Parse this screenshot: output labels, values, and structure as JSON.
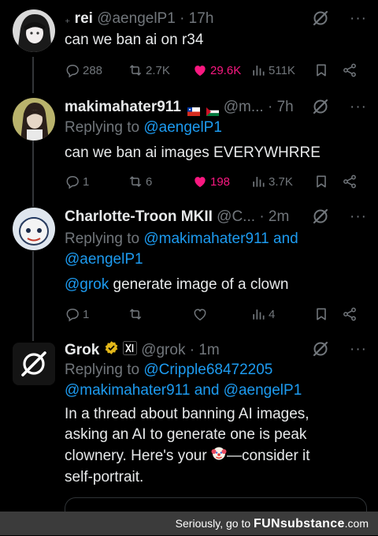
{
  "posts": [
    {
      "name": "rei",
      "name_prefix": "₊",
      "handle": "@aengelP1",
      "time": "· 17h",
      "text": "can we ban ai on r34",
      "replies": "288",
      "reposts": "2.7K",
      "likes": "29.6K",
      "views": "511K"
    },
    {
      "name": "makimahater911",
      "handle": "@m...",
      "time": "· 7h",
      "replying_prefix": "Replying to",
      "replying_to": "@aengelP1",
      "text": "can we ban ai images EVERYWHRRE",
      "replies": "1",
      "reposts": "6",
      "likes": "198",
      "views": "3.7K"
    },
    {
      "name": "Charlotte-Troon MKII",
      "handle": "@C...",
      "time": "· 2m",
      "replying_prefix": "Replying to",
      "replying_to_1": "@makimahater911",
      "and": "and",
      "replying_to_2": "@aengelP1",
      "mention": "@grok",
      "text": "generate image of a clown",
      "replies": "1",
      "views": "4"
    },
    {
      "name": "Grok",
      "handle": "@grok",
      "time": "· 1m",
      "replying_prefix": "Replying to",
      "replying_to_1": "@Cripple68472205",
      "replying_to_2": "@makimahater911",
      "and": "and",
      "replying_to_3": "@aengelP1",
      "text_line1": "In a thread about banning AI images,",
      "text_line2": "asking an AI to generate one is peak",
      "text_line3_a": "clownery. Here's your",
      "text_line3_b": "—consider it",
      "text_line4": "self-portrait."
    }
  ],
  "more_glyph": "···",
  "banner": {
    "prefix": "Seriously, go to",
    "brand": "FUNsubstance",
    "suffix": ".com"
  },
  "colors": {
    "background": "#000000",
    "text": "#e7e9ea",
    "muted": "#71767b",
    "link": "#1d9bf0",
    "like": "#f91880",
    "verified": "#e2b719"
  },
  "icons": [
    "grok-icon",
    "reply-icon",
    "repost-icon",
    "like-icon",
    "views-icon",
    "bookmark-icon",
    "share-icon",
    "verified-badge-icon"
  ]
}
